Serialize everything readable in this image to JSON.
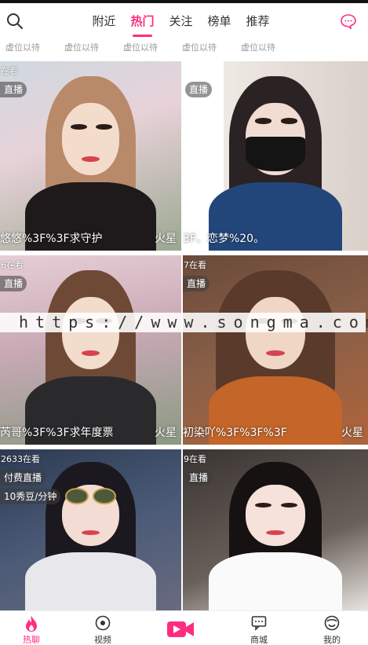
{
  "header": {
    "tabs": [
      {
        "label": "附近",
        "active": false
      },
      {
        "label": "热门",
        "active": true
      },
      {
        "label": "关注",
        "active": false
      },
      {
        "label": "榜单",
        "active": false
      },
      {
        "label": "推荐",
        "active": false
      }
    ],
    "search_icon": "search-icon",
    "message_icon": "chat-bubble-icon"
  },
  "subtabs": [
    "虚位以待",
    "虚位以待",
    "虚位以待",
    "虚位以待",
    "虚位以待"
  ],
  "cards": [
    {
      "viewers": "在看",
      "badge": "直播",
      "price": "",
      "caption": "悠悠%3F%3F求守护",
      "tag": "火星"
    },
    {
      "viewers": "",
      "badge": "直播",
      "price": "",
      "caption": "3F、恋梦%20。",
      "tag": ""
    },
    {
      "viewers": "6在看",
      "badge": "直播",
      "price": "",
      "caption": "芮哥%3F%3F求年度票",
      "tag": "火星"
    },
    {
      "viewers": "7在看",
      "badge": "直播",
      "price": "",
      "caption": "初染吖%3F%3F%3F",
      "tag": "火星"
    },
    {
      "viewers": "2633在看",
      "badge": "付费直播",
      "price": "10秀豆/分钟",
      "caption": "",
      "tag": ""
    },
    {
      "viewers": "9在看",
      "badge": "直播",
      "price": "",
      "caption": "",
      "tag": ""
    }
  ],
  "watermark": "https://www.songma.com",
  "bottom_nav": [
    {
      "label": "热聊",
      "icon": "flame-icon",
      "active": true
    },
    {
      "label": "视频",
      "icon": "video-disc-icon",
      "active": false
    },
    {
      "label": "",
      "icon": "camera-live-icon",
      "active": false
    },
    {
      "label": "商城",
      "icon": "mall-chat-icon",
      "active": false
    },
    {
      "label": "我的",
      "icon": "profile-face-icon",
      "active": false
    }
  ],
  "colors": {
    "accent": "#ff2d80",
    "badge_bg": "rgba(60,60,60,0.55)",
    "text": "#333333"
  }
}
